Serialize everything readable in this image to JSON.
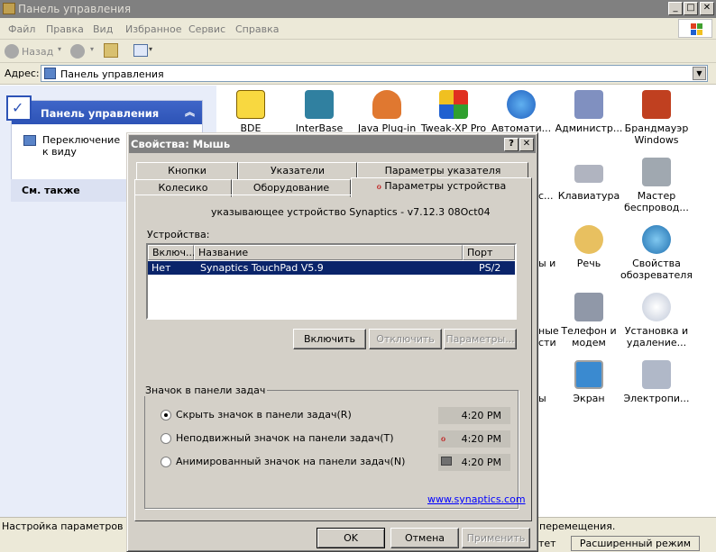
{
  "window": {
    "title": "Панель управления"
  },
  "menu": [
    "Файл",
    "Правка",
    "Вид",
    "Избранное",
    "Сервис",
    "Справка"
  ],
  "toolbar": {
    "back_label": "Назад"
  },
  "address": {
    "label": "Адрес:",
    "value": "Панель управления"
  },
  "left_pane": {
    "panel_title": "Панель управления",
    "switch_link": "Переключение к виду категорий",
    "see_also": "См. также"
  },
  "icons": [
    {
      "label": "BDE Administrator",
      "visible_label": "BDE"
    },
    {
      "label": "InterBase",
      "visible_label": "InterBase"
    },
    {
      "label": "Java Plug-in",
      "visible_label": "Java Plug-in"
    },
    {
      "label": "Tweak-XP Pro",
      "visible_label": "Tweak-XP Pro"
    },
    {
      "label": "Автомати... обновление",
      "visible_label": "Автомати...\nие"
    },
    {
      "label": "Администр...",
      "visible_label": "Администр..."
    },
    {
      "label": "Брандмауэр Windows",
      "visible_label": "Брандмауэр\nWindows"
    },
    {
      "label": "Клавиатура",
      "visible_label": "Клавиатура"
    },
    {
      "label": "Мастер беспровод...",
      "visible_label": "Мастер\nбеспровод..."
    },
    {
      "label": "Речь",
      "visible_label": "Речь"
    },
    {
      "label": "Свойства обозревателя",
      "visible_label": "Свойства\nобозревателя"
    },
    {
      "label": "Телефон и модем",
      "visible_label": "Телефон и\nмодем"
    },
    {
      "label": "Установка и удаление...",
      "visible_label": "Установка и\nудаление..."
    },
    {
      "label": "Экран",
      "visible_label": "Экран"
    },
    {
      "label": "Электропи...",
      "visible_label": "Электропи..."
    }
  ],
  "partial_labels": [
    "с...",
    "ы и",
    "ные\nсти",
    "ы"
  ],
  "status": {
    "text": "Настройка параметров мыш",
    "text_right": "перемещения."
  },
  "bottom": {
    "left": "тет",
    "extended": "Расширенный режим"
  },
  "dialog": {
    "title": "Свойства: Мышь",
    "help": "?",
    "close": "✕",
    "tabs_row1": [
      "Кнопки",
      "Указатели",
      "Параметры указателя"
    ],
    "tabs_row2": [
      "Колесико",
      "Оборудование",
      "Параметры устройства"
    ],
    "device_caption": "указывающее устройство Synaptics - v7.12.3 08Oct04",
    "devices_label": "Устройства:",
    "columns": [
      "Включ...",
      "Название",
      "Порт"
    ],
    "rows": [
      {
        "enabled": "Нет",
        "name": "Synaptics TouchPad V5.9",
        "port": "PS/2"
      }
    ],
    "buttons": {
      "enable": "Включить",
      "disable": "Отключить",
      "params": "Параметры..."
    },
    "tray_group": "Значок в панели задач",
    "tray_options": [
      {
        "label": "Скрыть значок в панели задач(R)",
        "time": "4:20 PM",
        "selected": true
      },
      {
        "label": "Неподвижный значок на панели задач(T)",
        "time": "4:20 PM",
        "selected": false
      },
      {
        "label": "Анимированный значок на панели задач(N)",
        "time": "4:20 PM",
        "selected": false
      }
    ],
    "link": "www.synaptics.com",
    "ok": "OK",
    "cancel": "Отмена",
    "apply": "Применить"
  }
}
